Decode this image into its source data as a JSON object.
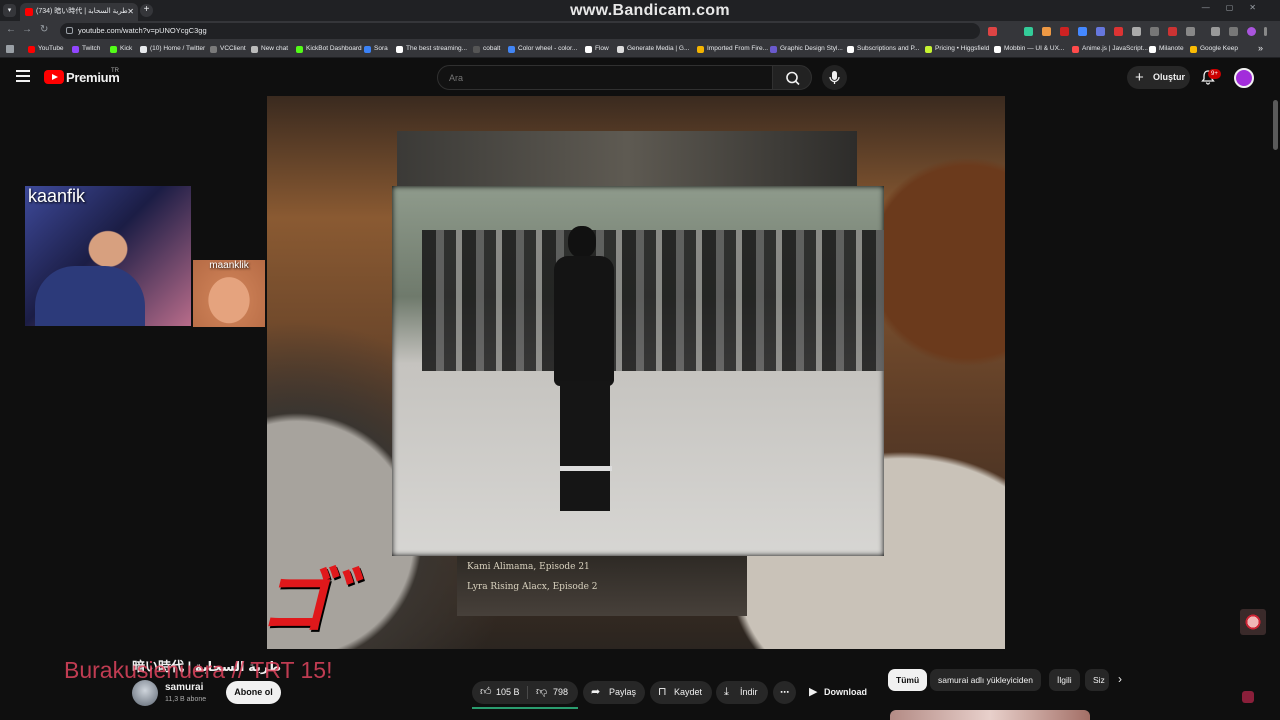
{
  "browser": {
    "active_tab_title": "(734) 暗い時代 | طرية السحابة",
    "watermark": "www.Bandicam.com",
    "url": "youtube.com/watch?v=pUNOYcgC3gg",
    "bookmarks": [
      {
        "label": "YouTube",
        "color": "#ff0000"
      },
      {
        "label": "Twitch",
        "color": "#9146ff"
      },
      {
        "label": "Kick",
        "color": "#53fc18"
      },
      {
        "label": "(10) Home / Twitter",
        "color": "#e8eaed"
      },
      {
        "label": "VCClient",
        "color": "#7a7a7a"
      },
      {
        "label": "New chat",
        "color": "#bbbbbb"
      },
      {
        "label": "KickBot Dashboard",
        "color": "#53fc18"
      },
      {
        "label": "Sora",
        "color": "#3b82f6"
      },
      {
        "label": "The best streaming...",
        "color": "#ffffff"
      },
      {
        "label": "cobalt",
        "color": "#555555"
      },
      {
        "label": "Color wheel - color...",
        "color": "#4285f4"
      },
      {
        "label": "Flow",
        "color": "#ffffff"
      },
      {
        "label": "Generate Media | G...",
        "color": "#dddddd"
      },
      {
        "label": "Imported From Fire...",
        "color": "#f4b400"
      },
      {
        "label": "Graphic Design Styl...",
        "color": "#6a5acd"
      },
      {
        "label": "Subscriptions and P...",
        "color": "#ffffff"
      },
      {
        "label": "Pricing • Higgsfield",
        "color": "#c6f432"
      },
      {
        "label": "Mobbin — UI & UX...",
        "color": "#ffffff"
      },
      {
        "label": "Anime.js | JavaScript...",
        "color": "#ff4b4b"
      },
      {
        "label": "Milanote",
        "color": "#ffffff"
      },
      {
        "label": "Google Keep",
        "color": "#fbbc04"
      }
    ]
  },
  "masthead": {
    "logo_text": "Premium",
    "country": "TR",
    "search_placeholder": "Ara",
    "create_label": "Oluştur",
    "notifications": "9+"
  },
  "player": {
    "lower_lines": [
      "Kami Alimama, Episode 21",
      "Lyra Rising Alacx, Episode 2"
    ],
    "jojo_mark": "ゴ゛"
  },
  "overlays": {
    "main_cam": "kaanfik",
    "guest_cam": "maanklik"
  },
  "video": {
    "title": "暗い時代 | طرية السحابة",
    "caption_overlay": "Burakusienuera // TRT 15!",
    "channel": "samurai",
    "subscribers": "11,3 B abone",
    "subscribe_label": "Abone ol",
    "likes": "105 B",
    "dislikes": "798",
    "share_label": "Paylaş",
    "save_label": "Kaydet",
    "download_label": "İndir",
    "download_ext_label": "Download"
  },
  "chips": [
    "Tümü",
    "samurai adlı yükleyiciden",
    "İlgili",
    "Siz"
  ]
}
